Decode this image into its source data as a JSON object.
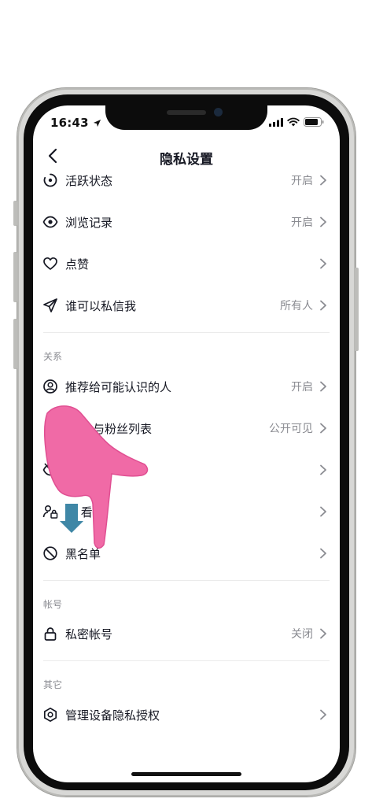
{
  "status_bar": {
    "time": "16:43"
  },
  "header": {
    "title": "隐私设置"
  },
  "rows": {
    "activity_status": {
      "label": "活跃状态",
      "value": "开启"
    },
    "browse_history": {
      "label": "浏览记录",
      "value": "开启"
    },
    "likes": {
      "label": "点赞",
      "value": ""
    },
    "who_can_message": {
      "label": "谁可以私信我",
      "value": "所有人"
    },
    "recommend_to_acquaintances": {
      "label": "推荐给可能认识的人",
      "value": "开启"
    },
    "following_followers_list": {
      "label": "与粉丝列表",
      "value": "公开可见"
    },
    "hidden_row": {
      "label": "",
      "value": ""
    },
    "dont_let_see": {
      "label": "让  看",
      "value": ""
    },
    "blacklist": {
      "label": "黑名单",
      "value": ""
    },
    "private_account": {
      "label": "私密帐号",
      "value": "关闭"
    },
    "device_privacy_auth": {
      "label": "管理设备隐私授权",
      "value": ""
    }
  },
  "sections": {
    "relations": "关系",
    "account": "帐号",
    "other": "其它"
  },
  "icons": {
    "activity": "activity-status-icon",
    "eye": "eye-icon",
    "heart": "heart-icon",
    "send": "paper-plane-icon",
    "person_circle": "person-circle-icon",
    "eye_off": "eye-off-icon",
    "person_lock": "person-lock-icon",
    "block": "block-icon",
    "lock": "lock-icon",
    "shield": "shield-hexagon-icon",
    "chevron": "chevron-right-icon"
  },
  "colors": {
    "text_primary": "#161823",
    "text_secondary": "#8a8b91",
    "hand_overlay": "#f06aa6",
    "arrow_overlay": "#3f87a6"
  }
}
